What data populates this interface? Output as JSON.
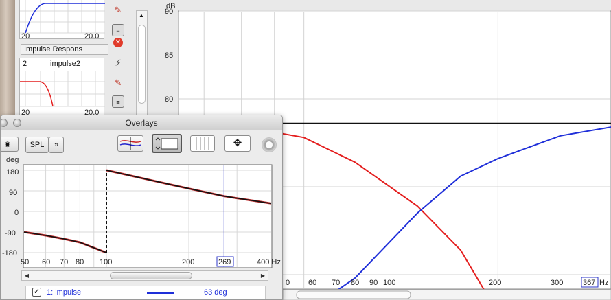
{
  "main_chart": {
    "y_unit": "dB",
    "x_unit": "Hz",
    "y_ticks": [
      90,
      85,
      80
    ],
    "x_ticks": [
      "60",
      "70",
      "80",
      "90",
      "100",
      "200",
      "300"
    ],
    "x_start_label": "0",
    "cursor_readout": "367",
    "colors": {
      "red": "#e41e1e",
      "blue": "#1f2fd9",
      "black": "#111111",
      "cursor": "#2b35c8"
    }
  },
  "thumb_top": {
    "label_left": "20",
    "label_right": "20.0"
  },
  "impulse_panel": {
    "header": "Impulse Respons",
    "index": "2",
    "name": "impulse2",
    "label_left": "20",
    "label_right": "20.0"
  },
  "overlays": {
    "title": "Overlays",
    "spl_button": "SPL",
    "more_button": "»",
    "icons": [
      "equalize-icon",
      "graph-select-icon",
      "table-view-icon",
      "expand-icon",
      "gear-icon"
    ],
    "phase_chart": {
      "y_unit": "deg",
      "y_ticks": [
        "180",
        "90",
        "0",
        "-90",
        "-180"
      ],
      "x_ticks": [
        "50",
        "60",
        "70",
        "80",
        "100",
        "200"
      ],
      "x_last": "400 Hz",
      "cursor_readout": "269"
    },
    "legend": {
      "name": "1: impulse",
      "value": "63 deg"
    }
  },
  "chart_data": [
    {
      "type": "line",
      "title": "",
      "xlabel": "Hz",
      "ylabel": "dB",
      "x_scale": "log",
      "xlim": [
        50,
        400
      ],
      "ylim": [
        70,
        90
      ],
      "grid": true,
      "cursor_x": 367,
      "series": [
        {
          "color": "#111111",
          "x": [
            50,
            100,
            200,
            367,
            400
          ],
          "y": [
            83.6,
            83.6,
            83.6,
            83.6,
            83.6
          ]
        },
        {
          "color": "#e41e1e",
          "x": [
            50,
            60,
            70,
            80,
            90,
            100,
            120,
            150,
            175,
            200
          ],
          "y": [
            83.6,
            83.6,
            83.5,
            83.4,
            83.1,
            82.8,
            81.4,
            78.9,
            76.4,
            72.8
          ]
        },
        {
          "color": "#1f2fd9",
          "x": [
            100,
            120,
            150,
            175,
            200,
            250,
            300,
            367
          ],
          "y": [
            72.8,
            74.8,
            78.5,
            80.6,
            81.6,
            82.9,
            83.4,
            83.6
          ]
        }
      ]
    },
    {
      "type": "line",
      "title": "",
      "xlabel": "Hz",
      "ylabel": "deg",
      "x_scale": "log",
      "xlim": [
        50,
        400
      ],
      "ylim": [
        -180,
        180
      ],
      "grid": true,
      "cursor_x": 269,
      "series": [
        {
          "color": "#111111",
          "x": [
            50,
            60,
            70,
            80,
            100
          ],
          "y": [
            -90,
            -105,
            -120,
            -135,
            -180
          ]
        },
        {
          "color": "#111111",
          "x": [
            100,
            120,
            150,
            200,
            269,
            300,
            400
          ],
          "y": [
            180,
            159,
            133,
            100,
            67,
            58,
            35
          ]
        }
      ]
    }
  ]
}
